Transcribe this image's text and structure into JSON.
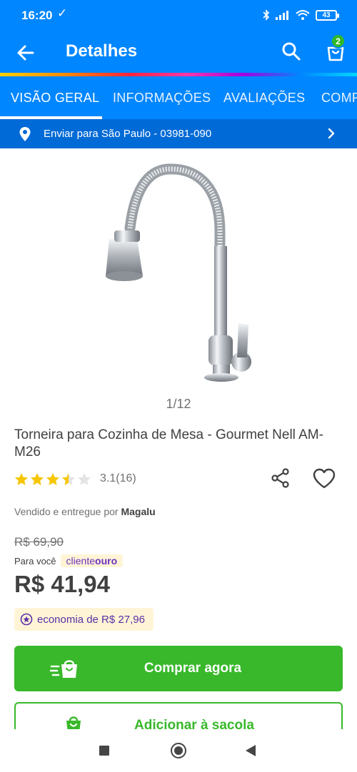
{
  "status_bar": {
    "time": "16:20",
    "battery": "43"
  },
  "header": {
    "title": "Detalhes",
    "cart_count": "2"
  },
  "tabs": [
    {
      "label": "VISÃO GERAL",
      "active": true
    },
    {
      "label": "INFORMAÇÕES",
      "active": false
    },
    {
      "label": "AVALIAÇÕES",
      "active": false
    },
    {
      "label": "COMP",
      "active": false
    }
  ],
  "delivery": {
    "text": "Enviar para São Paulo - 03981-090"
  },
  "product": {
    "image_counter": "1/12",
    "title": "Torneira para Cozinha de Mesa - Gourmet Nell AM-M26",
    "rating": 3.5,
    "rating_text": "3.1(16)",
    "seller_prefix": "Vendido e entregue por",
    "seller_name": "Magalu",
    "old_price": "R$ 69,90",
    "para_voce": "Para você",
    "cliente_prefix": "cliente",
    "cliente_suffix": "ouro",
    "price": "R$ 41,94",
    "savings": "economia de R$ 27,96"
  },
  "buttons": {
    "buy": "Comprar agora",
    "add": "Adicionar à sacola"
  },
  "colors": {
    "brand_blue": "#0086ff",
    "delivery_blue": "#006ad6",
    "buy_green": "#38b82a",
    "star_yellow": "#f7c600"
  }
}
